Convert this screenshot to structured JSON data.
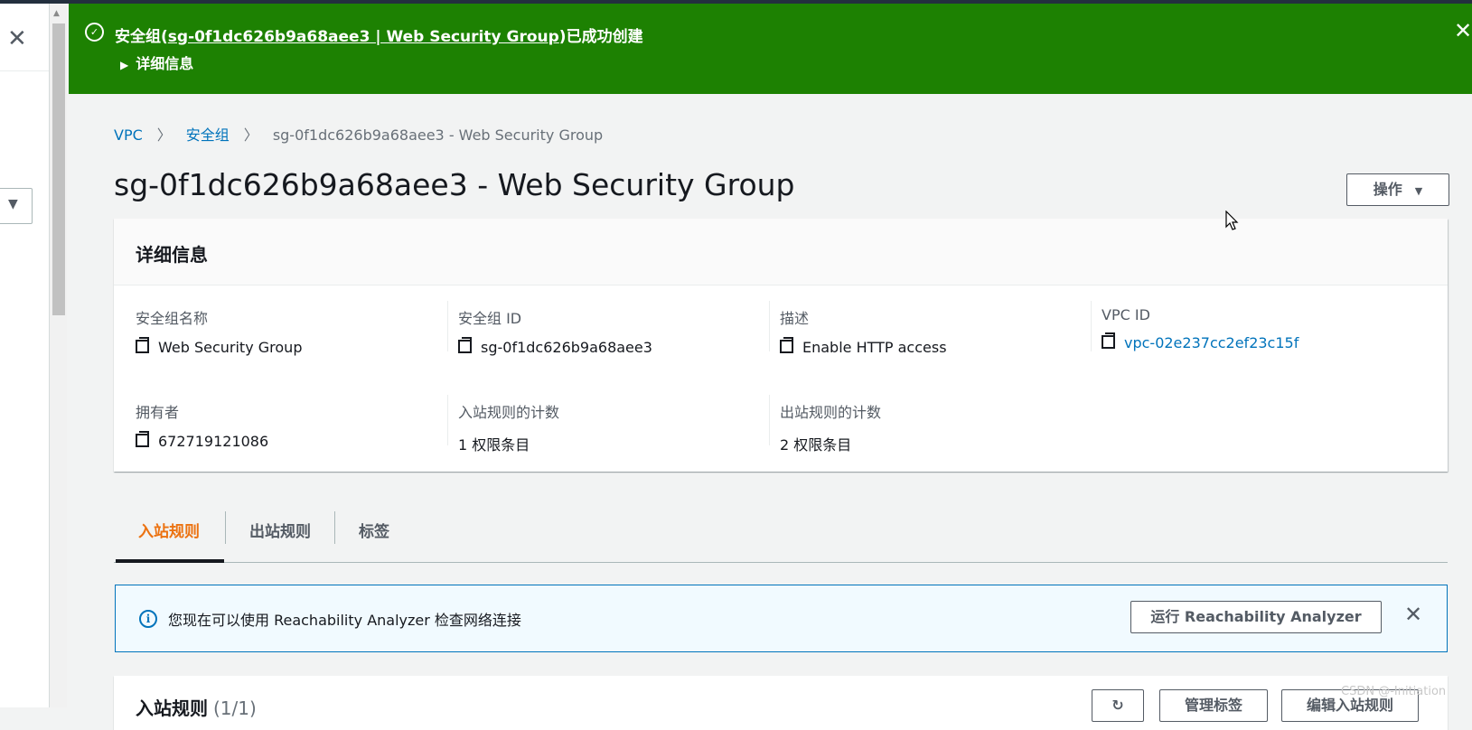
{
  "flash": {
    "prefix": "安全组(",
    "link": "sg-0f1dc626b9a68aee3 | Web Security Group",
    "suffix": ")已成功创建",
    "details_label": "详细信息"
  },
  "breadcrumb": {
    "vpc": "VPC",
    "security_groups": "安全组",
    "current": "sg-0f1dc626b9a68aee3 - Web Security Group"
  },
  "page_title": "sg-0f1dc626b9a68aee3 - Web Security Group",
  "actions_label": "操作",
  "details": {
    "header": "详细信息",
    "fields": [
      {
        "label": "安全组名称",
        "value": "Web Security Group"
      },
      {
        "label": "安全组 ID",
        "value": "sg-0f1dc626b9a68aee3"
      },
      {
        "label": "描述",
        "value": "Enable HTTP access"
      },
      {
        "label": "VPC ID",
        "value": "vpc-02e237cc2ef23c15f"
      },
      {
        "label": "拥有者",
        "value": "672719121086"
      },
      {
        "label": "入站规则的计数",
        "value": "1 权限条目"
      },
      {
        "label": "出站规则的计数",
        "value": "2 权限条目"
      }
    ]
  },
  "tabs": [
    {
      "label": "入站规则",
      "active": true
    },
    {
      "label": "出站规则",
      "active": false
    },
    {
      "label": "标签",
      "active": false
    }
  ],
  "info_alert": {
    "text": "您现在可以使用 Reachability Analyzer 检查网络连接",
    "button": "运行 Reachability Analyzer"
  },
  "inbound_rules": {
    "title": "入站规则",
    "count": "(1/1)",
    "buttons": [
      "管理标签",
      "编辑入站规则"
    ]
  },
  "watermark": "CSDN @-Initiation",
  "colors": {
    "success": "#1d8102",
    "link": "#0073bb",
    "active_tab": "#ec7211",
    "info_bg": "#f1faff"
  }
}
